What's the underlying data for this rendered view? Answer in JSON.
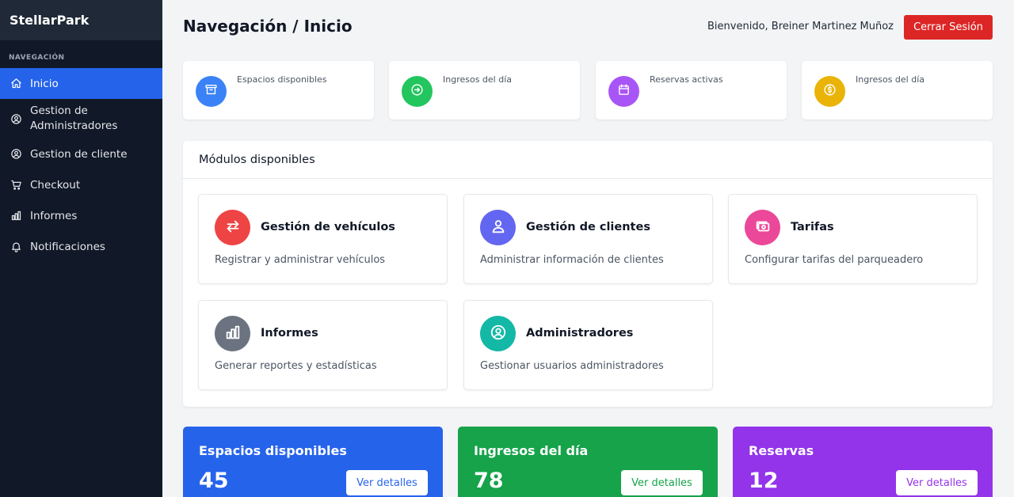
{
  "sidebar": {
    "brand": "StellarPark",
    "heading": "NAVEGACIÓN",
    "items": [
      {
        "label": "Inicio",
        "icon": "home-icon"
      },
      {
        "label": "Gestion de Administradores",
        "line1": "Gestion de",
        "line2": "Administradores",
        "icon": "user-circle-icon"
      },
      {
        "label": "Gestion de cliente",
        "icon": "user-circle-icon"
      },
      {
        "label": "Checkout",
        "icon": "cart-icon"
      },
      {
        "label": "Informes",
        "icon": "bar-chart-icon"
      },
      {
        "label": "Notificaciones",
        "icon": "bell-icon"
      }
    ]
  },
  "header": {
    "title": "Navegación / Inicio",
    "welcome": "Bienvenido, Breiner Martinez Muñoz",
    "logout_label": "Cerrar Sesión"
  },
  "stats": [
    {
      "label": "Espacios disponibles",
      "icon": "archive-icon",
      "color": "#3b82f6"
    },
    {
      "label": "Ingresos del día",
      "icon": "arrow-circle-icon",
      "color": "#22c55e"
    },
    {
      "label": "Reservas activas",
      "icon": "calendar-icon",
      "color": "#a855f7"
    },
    {
      "label": "Ingresos del día",
      "icon": "dollar-circle-icon",
      "color": "#eab308"
    }
  ],
  "modules": {
    "title": "Módulos disponibles",
    "items": [
      {
        "title": "Gestión de vehículos",
        "description": "Registrar y administrar vehículos",
        "icon": "swap-arrows-icon",
        "color": "#ef4444"
      },
      {
        "title": "Gestión de clientes",
        "description": "Administrar información de clientes",
        "icon": "users-icon",
        "color": "#6366f1"
      },
      {
        "title": "Tarifas",
        "description": "Configurar tarifas del parqueadero",
        "icon": "cash-icon",
        "color": "#ec4899"
      },
      {
        "title": "Informes",
        "description": "Generar reportes y estadísticas",
        "icon": "bar-chart-icon",
        "color": "#6b7280"
      },
      {
        "title": "Administradores",
        "description": "Gestionar usuarios administradores",
        "icon": "user-circle-icon",
        "color": "#14b8a6"
      }
    ]
  },
  "summary": [
    {
      "title": "Espacios disponibles",
      "value": "45",
      "button": "Ver detalles",
      "color": "#2563eb"
    },
    {
      "title": "Ingresos del día",
      "value": "78",
      "button": "Ver detalles",
      "color": "#16a34a"
    },
    {
      "title": "Reservas",
      "value": "12",
      "button": "Ver detalles",
      "color": "#9333ea"
    }
  ]
}
